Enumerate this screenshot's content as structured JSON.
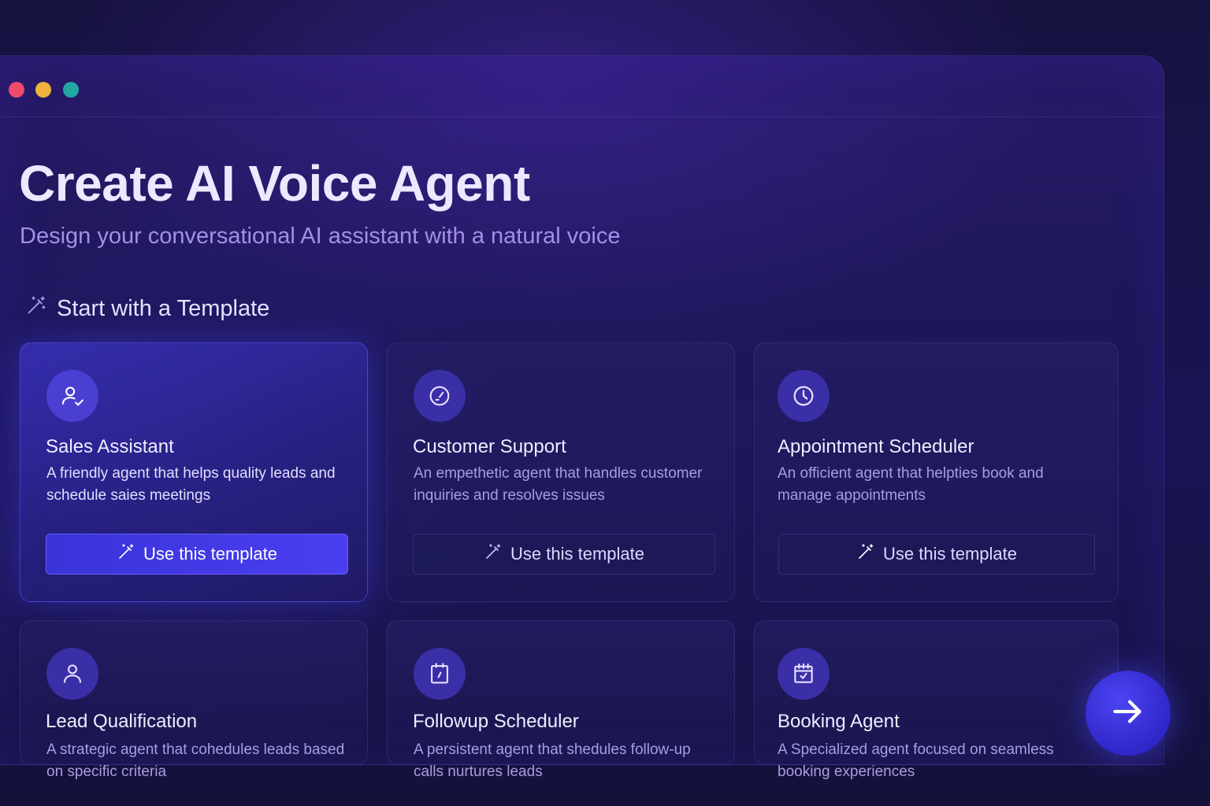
{
  "window": {
    "controls": [
      "close",
      "minimize",
      "maximize"
    ]
  },
  "header": {
    "title": "Create AI Voice Agent",
    "subtitle": "Design your conversational AI assistant with a natural voice"
  },
  "section": {
    "heading": "Start with a Template",
    "icon": "magic-wand-icon"
  },
  "templates": [
    {
      "title": "Sales Assistant",
      "description": "A friendly agent that helps quality leads and schedule saies meetings",
      "icon": "user-check-icon",
      "button_label": "Use this template",
      "selected": true
    },
    {
      "title": "Customer Support",
      "description": "An empethetic agent that handles customer inquiries and resolves issues",
      "icon": "support-clock-icon",
      "button_label": "Use this template",
      "selected": false
    },
    {
      "title": "Appointment Scheduler",
      "description": "An officient agent that helpties book and manage appointments",
      "icon": "clock-icon",
      "button_label": "Use this template",
      "selected": false
    },
    {
      "title": "Lead Qualification",
      "description": "A strategic agent that cohedules leads based on specific criteria",
      "icon": "user-icon",
      "selected": false
    },
    {
      "title": "Followup Scheduler",
      "description": "A persistent agent that shedules follow-up calls nurtures leads",
      "icon": "clipboard-icon",
      "selected": false
    },
    {
      "title": "Booking Agent",
      "description": "A Specialized agent focused on seamless booking experiences",
      "icon": "calendar-check-icon",
      "selected": false
    }
  ],
  "next_button": {
    "icon": "arrow-right-icon"
  },
  "colors": {
    "background": "#14113a",
    "accent": "#4a3ff0",
    "subtitle": "#a38fe6",
    "title": "#ece8ff"
  }
}
